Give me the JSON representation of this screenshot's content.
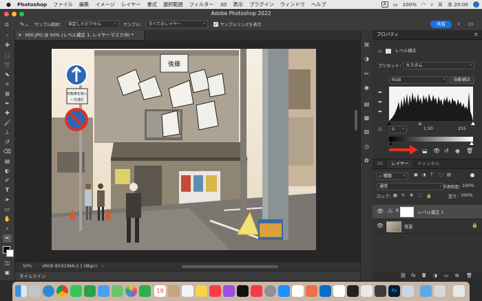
{
  "menubar": {
    "apple": "",
    "app_name": "Photoshop",
    "items": [
      "ファイル",
      "編集",
      "イメージ",
      "レイヤー",
      "書式",
      "選択範囲",
      "フィルター",
      "3D",
      "表示",
      "プラグイン",
      "ウィンドウ",
      "ヘルプ"
    ],
    "status_percent": "100%",
    "clock": "水 20:00",
    "input_mode": "A"
  },
  "window": {
    "title": "Adobe Photoshop 2022"
  },
  "options_bar": {
    "sample_size_label": "サンプル範囲：",
    "sample_size_value": "指定したピクセル",
    "sample_label": "サンプル：",
    "sample_value": "すべてのレイヤー",
    "show_ring_label": "サンプルリングを表示",
    "share_label": "共有"
  },
  "document": {
    "tab_label": "000.JPG @ 50% (レベル補正 1, レイヤーマスク/8) *",
    "zoom": "50%",
    "color_profile": "sRGB IEC61966-2.1 (8bpc)",
    "photo_signs": {
      "shop_sign": "後藤",
      "direction_sign": "日転車を除く 一方通行"
    }
  },
  "timeline_label": "タイムライン",
  "properties": {
    "title": "プロパティ",
    "adjustment_name": "レベル補正",
    "preset_label": "プリセット：",
    "preset_value": "カスタム",
    "channel_value": "RGB",
    "auto_button": "自動補正",
    "input_black": "0",
    "input_gamma": "1.50",
    "input_white": "255",
    "output_black": "0",
    "output_white": "255",
    "accent_arrow_color": "#e8311c"
  },
  "layers_panel": {
    "tabs": [
      "3D",
      "レイヤー",
      "チャンネル"
    ],
    "active_tab": "レイヤー",
    "filter_kind": "種類",
    "blend_mode": "通常",
    "opacity_label": "不透明度：",
    "opacity_value": "100%",
    "lock_label": "ロック：",
    "fill_label": "塗り：",
    "fill_value": "100%",
    "layers": [
      {
        "name": "レベル補正 1",
        "visible": true,
        "selected": true
      },
      {
        "name": "背景",
        "visible": true,
        "selected": false
      }
    ]
  }
}
